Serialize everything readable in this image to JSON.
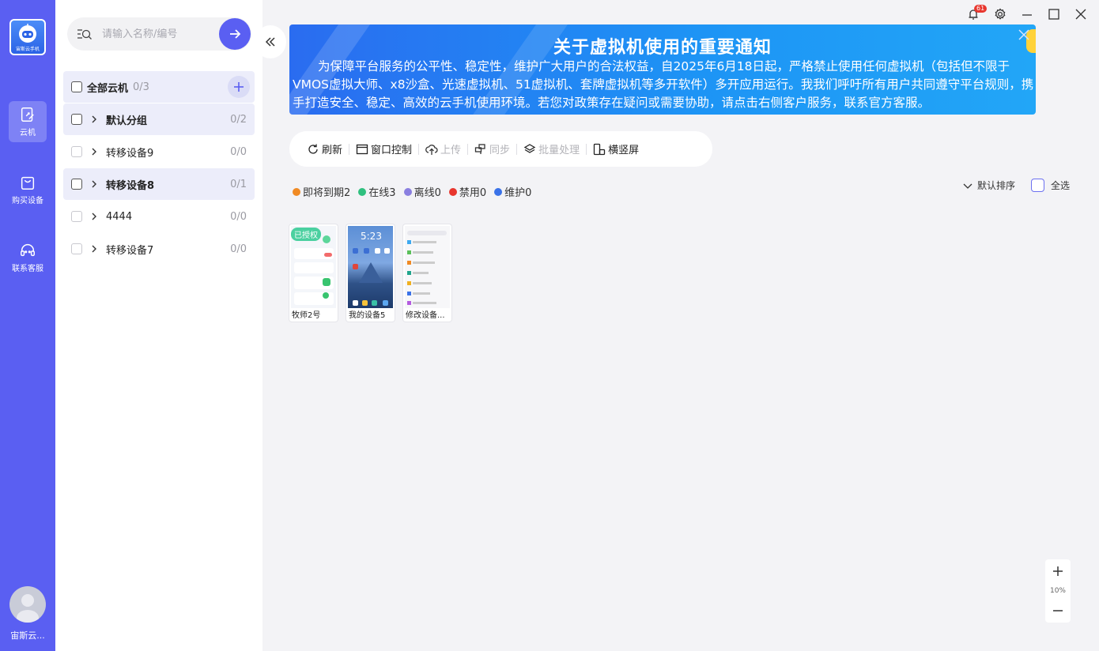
{
  "rail": {
    "items": [
      {
        "label": "云机",
        "icon": "cloud-phone-icon",
        "active": true
      },
      {
        "label": "购买设备",
        "icon": "shopping-bag-icon",
        "active": false
      },
      {
        "label": "联系客服",
        "icon": "headset-icon",
        "active": false
      }
    ],
    "username": "宙斯云...",
    "logo_text": "宙斯云手机"
  },
  "search": {
    "placeholder": "请输入名称/编号"
  },
  "groups": {
    "all": {
      "label": "全部云机",
      "count": "0/3"
    },
    "items": [
      {
        "label": "默认分组",
        "count": "0/2"
      },
      {
        "label": "转移设备9",
        "count": "0/0"
      },
      {
        "label": "转移设备8",
        "count": "0/1"
      },
      {
        "label": "4444",
        "count": "0/0"
      },
      {
        "label": "转移设备7",
        "count": "0/0"
      }
    ]
  },
  "window": {
    "notification_count": "61"
  },
  "notice": {
    "title": "关于虚拟机使用的重要通知",
    "body": "为保障平台服务的公平性、稳定性，维护广大用户的合法权益，自2025年6月18日起，严格禁止使用任何虚拟机（包括但不限于VMOS虚拟大师、x8沙盒、光速虚拟机、51虚拟机、套牌虚拟机等多开软件）多开应用运行。我我们呼吁所有用户共同遵守平台规则，携手打造安全、稳定、高效的云手机使用环境。若您对政策存在疑问或需要协助，请点击右侧客户服务，联系官方客服。"
  },
  "toolbar": {
    "refresh": "刷新",
    "window_control": "窗口控制",
    "upload": "上传",
    "sync": "同步",
    "batch": "批量处理",
    "orientation": "横竖屏"
  },
  "status": {
    "expiring": "即将到期2",
    "online": "在线3",
    "offline": "离线0",
    "disabled": "禁用0",
    "maintenance": "维护0"
  },
  "status_colors": {
    "expiring": "#f08a24",
    "online": "#2fc07f",
    "offline": "#8a7fe0",
    "disabled": "#e8362e",
    "maintenance": "#3a72e8"
  },
  "sort": {
    "label": "默认排序",
    "select_all": "全选"
  },
  "devices": [
    {
      "name": "牧师2号",
      "badge": "已授权"
    },
    {
      "name": "我的设备5",
      "time": "5:23"
    },
    {
      "name": "修改设备..."
    }
  ],
  "zoom": {
    "level": "10%"
  },
  "accent": "#5a5ff2"
}
